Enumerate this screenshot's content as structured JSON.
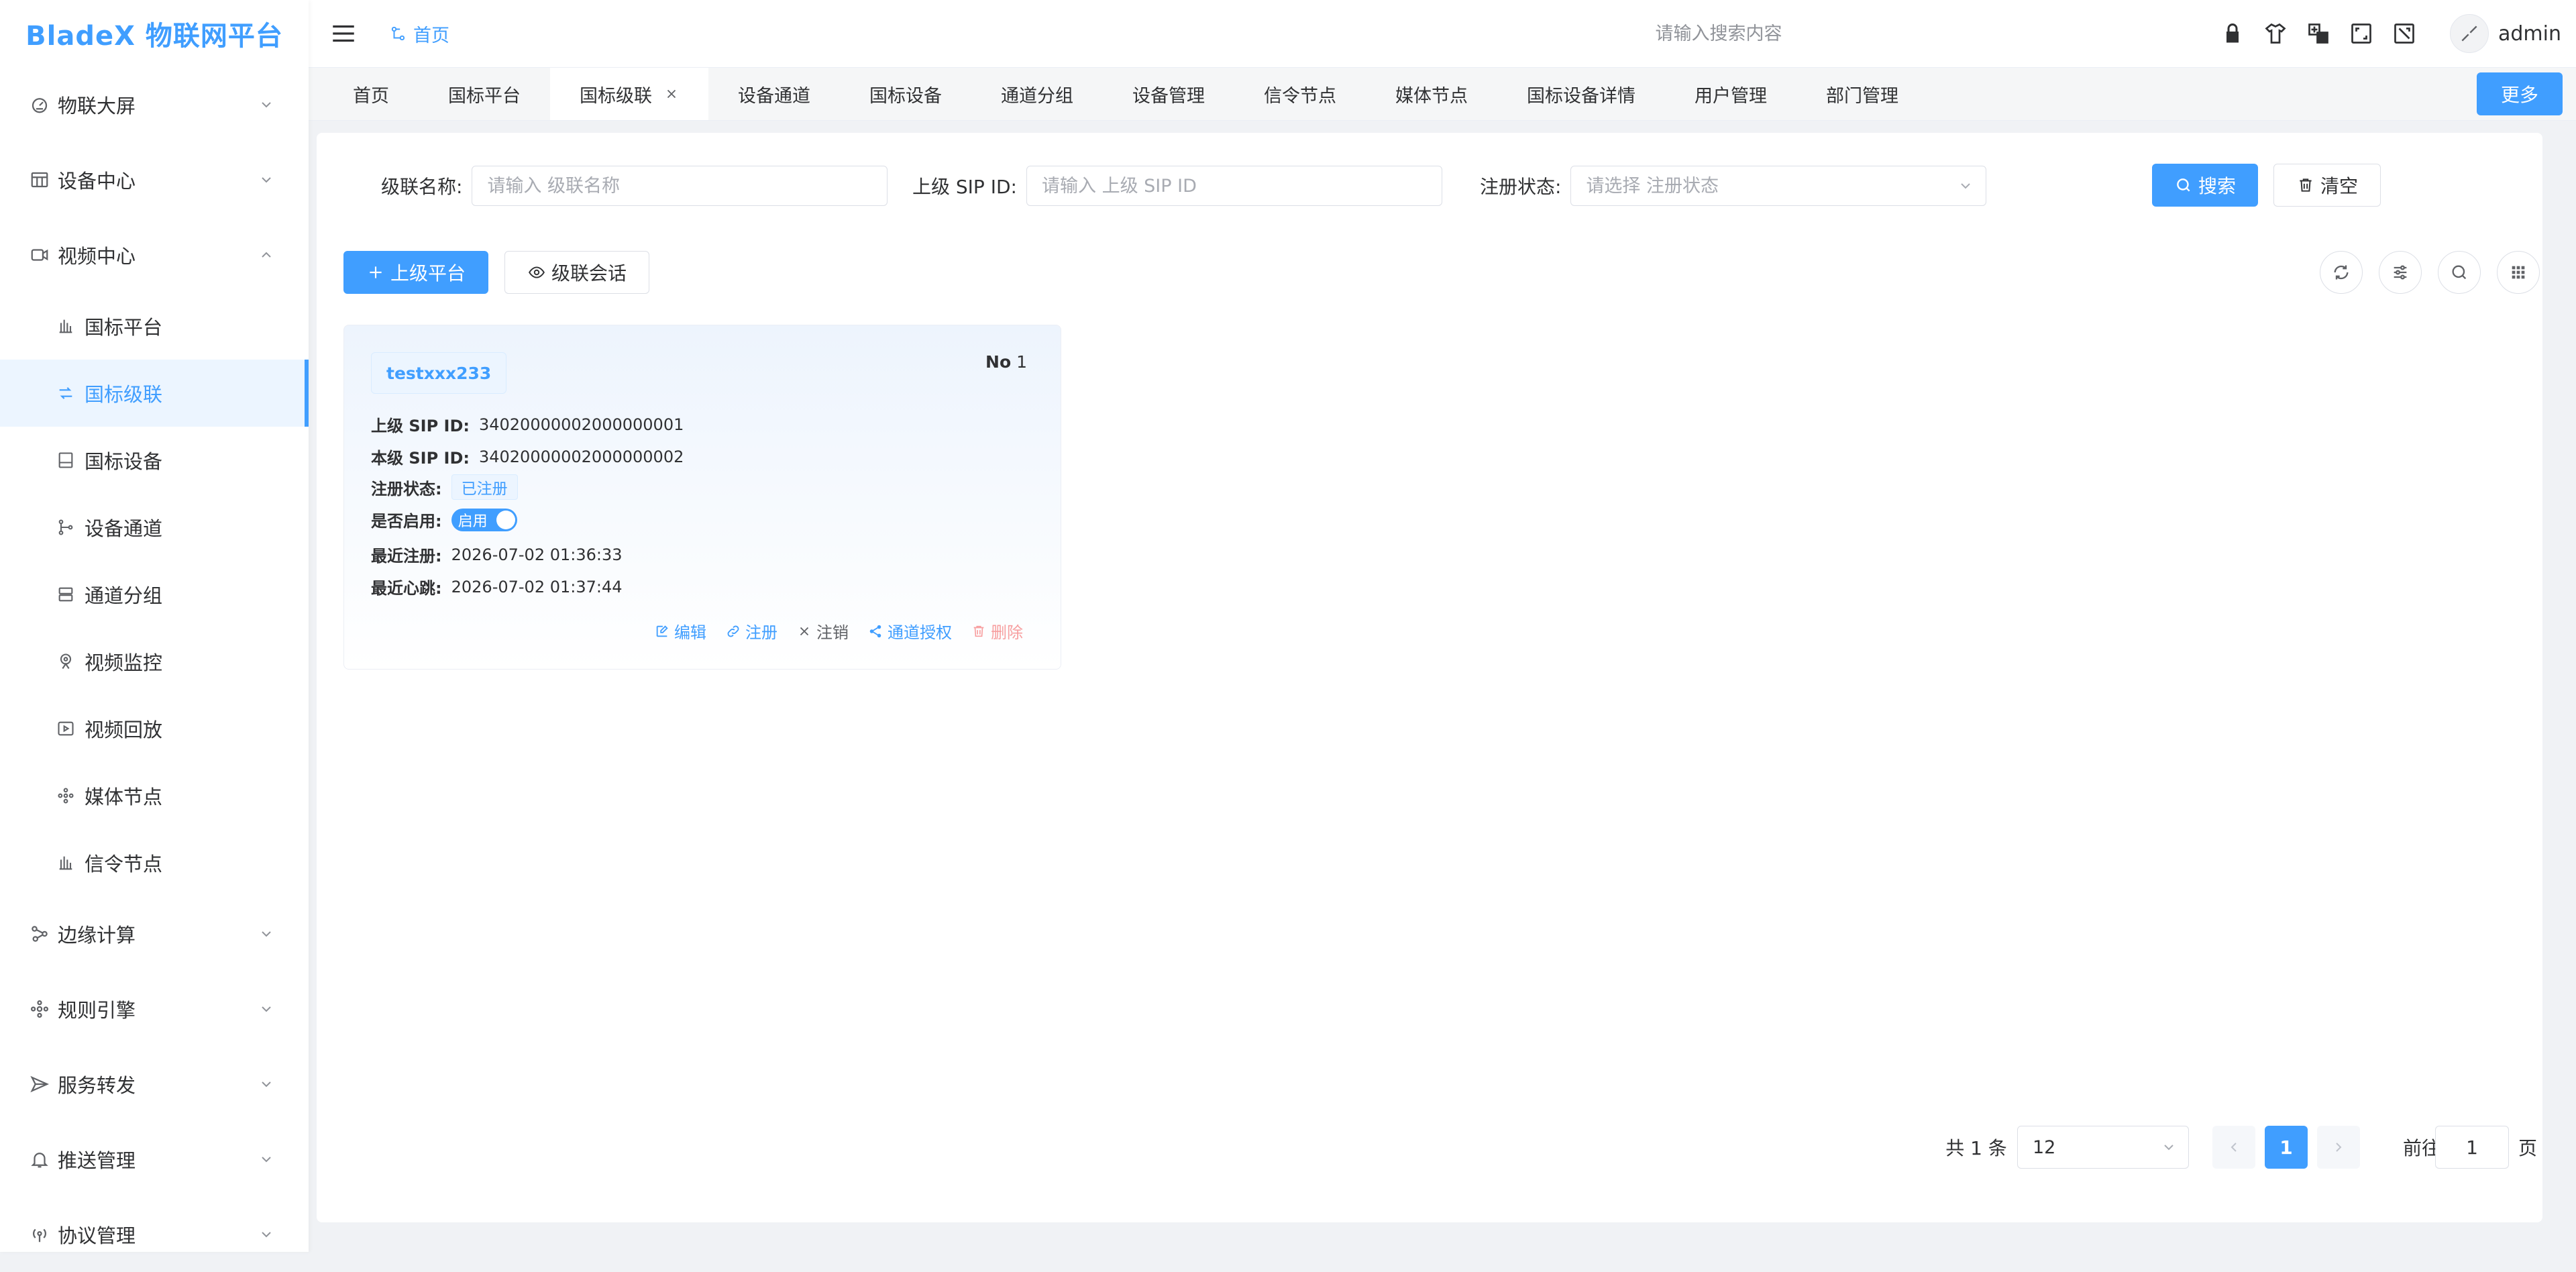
{
  "app": {
    "logo": "BladeX 物联网平台"
  },
  "header": {
    "breadcrumb": "首页",
    "search_placeholder": "请输入搜索内容",
    "username": "admin",
    "icons": [
      "lock-icon",
      "theme-shirt-icon",
      "language-icon",
      "fullscreen-icon",
      "screenshot-icon"
    ]
  },
  "sidebar": {
    "items": [
      {
        "label": "物联大屏",
        "icon": "dashboard-icon",
        "expanded": false
      },
      {
        "label": "设备中心",
        "icon": "device-center-icon",
        "expanded": false
      },
      {
        "label": "视频中心",
        "icon": "video-icon",
        "expanded": true,
        "children": [
          {
            "label": "国标平台",
            "icon": "platform-icon"
          },
          {
            "label": "国标级联",
            "icon": "cascade-icon",
            "active": true
          },
          {
            "label": "国标设备",
            "icon": "gb-device-icon"
          },
          {
            "label": "设备通道",
            "icon": "channel-icon"
          },
          {
            "label": "通道分组",
            "icon": "group-icon"
          },
          {
            "label": "视频监控",
            "icon": "camera-icon"
          },
          {
            "label": "视频回放",
            "icon": "playback-icon"
          },
          {
            "label": "媒体节点",
            "icon": "media-node-icon"
          },
          {
            "label": "信令节点",
            "icon": "signal-node-icon"
          }
        ]
      },
      {
        "label": "边缘计算",
        "icon": "edge-icon",
        "expanded": false
      },
      {
        "label": "规则引擎",
        "icon": "rule-icon",
        "expanded": false
      },
      {
        "label": "服务转发",
        "icon": "forward-icon",
        "expanded": false
      },
      {
        "label": "推送管理",
        "icon": "bell-icon",
        "expanded": false
      },
      {
        "label": "协议管理",
        "icon": "protocol-icon",
        "expanded": false
      }
    ]
  },
  "tabs": {
    "items": [
      {
        "label": "首页"
      },
      {
        "label": "国标平台"
      },
      {
        "label": "国标级联",
        "active": true,
        "closable": true
      },
      {
        "label": "设备通道"
      },
      {
        "label": "国标设备"
      },
      {
        "label": "通道分组"
      },
      {
        "label": "设备管理"
      },
      {
        "label": "信令节点"
      },
      {
        "label": "媒体节点"
      },
      {
        "label": "国标设备详情"
      },
      {
        "label": "用户管理"
      },
      {
        "label": "部门管理"
      }
    ],
    "more_label": "更多"
  },
  "filters": {
    "name_label": "级联名称:",
    "name_placeholder": "请输入 级联名称",
    "sip_label": "上级 SIP ID:",
    "sip_placeholder": "请输入 上级 SIP ID",
    "status_label": "注册状态:",
    "status_placeholder": "请选择 注册状态",
    "search_label": "搜索",
    "clear_label": "清空"
  },
  "toolbar": {
    "add_label": "上级平台",
    "session_label": "级联会话",
    "icons": [
      "refresh-icon",
      "filter-settings-icon",
      "search-icon",
      "grid-icon"
    ]
  },
  "card": {
    "title": "testxxx233",
    "no_label": "No",
    "no_value": "1",
    "upper_sip_label": "上级 SIP ID:",
    "upper_sip_value": "34020000002000000001",
    "local_sip_label": "本级 SIP ID:",
    "local_sip_value": "34020000002000000002",
    "status_label": "注册状态:",
    "status_value": "已注册",
    "enabled_label": "是否启用:",
    "enabled_value": "启用",
    "last_register_label": "最近注册:",
    "last_register_value": "2026-07-02 01:36:33",
    "last_heartbeat_label": "最近心跳:",
    "last_heartbeat_value": "2026-07-02 01:37:44",
    "actions": {
      "edit": "编辑",
      "register": "注册",
      "unregister": "注销",
      "authorize": "通道授权",
      "delete": "删除"
    }
  },
  "pagination": {
    "total": "共 1 条",
    "page_size": "12",
    "current": "1",
    "goto_label": "前往",
    "goto_value": "1",
    "page_suffix": "页"
  },
  "colors": {
    "primary": "#409eff",
    "danger": "#f56c6c",
    "text": "#303133"
  }
}
